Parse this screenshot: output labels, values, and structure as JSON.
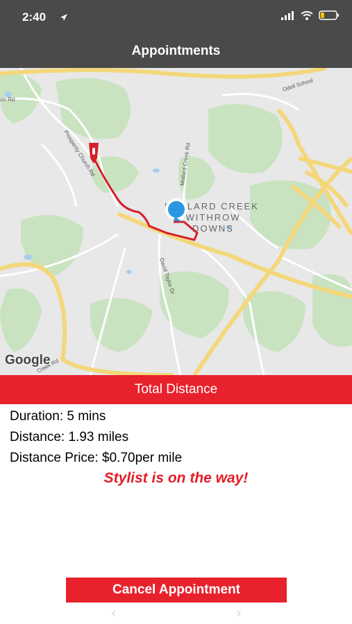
{
  "status_bar": {
    "time": "2:40",
    "icons": [
      "location-arrow-icon",
      "signal-icon",
      "wifi-icon",
      "battery-icon"
    ]
  },
  "header": {
    "title": "Appointments"
  },
  "map": {
    "provider_logo": "Google",
    "road_labels": [
      "Prosperity Church Rd",
      "Mallard Creek Rd",
      "David Taylor Dr",
      "Odell School",
      "on Rd",
      "Creek Rd"
    ],
    "neighborhood_label": [
      "MALLARD CREEK",
      "WITHROW",
      "DOWNS"
    ]
  },
  "distance_panel": {
    "title": "Total Distance",
    "duration": "Duration: 5 mins",
    "distance": "Distance: 1.93 miles",
    "price": "Distance Price: $0.70per mile",
    "status": "Stylist is on the way!"
  },
  "actions": {
    "cancel_label": "Cancel Appointment"
  },
  "colors": {
    "accent": "#e8222c",
    "header_bg": "#4a4a4a"
  }
}
